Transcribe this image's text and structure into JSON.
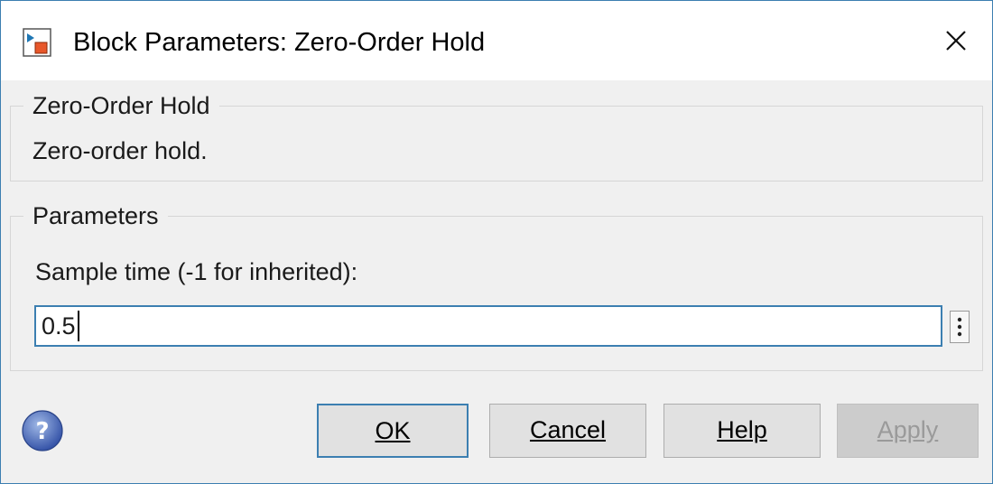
{
  "window": {
    "title": "Block Parameters: Zero-Order Hold",
    "icon": "simulink-block-icon",
    "close_icon": "close-icon"
  },
  "description": {
    "heading": "Zero-Order Hold",
    "text": "Zero-order hold."
  },
  "parameters": {
    "heading": "Parameters",
    "sample_time": {
      "label": "Sample time (-1 for inherited):",
      "value": "0.5"
    },
    "more_options_icon": "vertical-ellipsis-icon"
  },
  "footer": {
    "help_icon": "question-circle-icon",
    "ok_label": "OK",
    "cancel_label": "Cancel",
    "help_label": "Help",
    "apply_label": "Apply",
    "apply_enabled": false
  },
  "colors": {
    "accent": "#3c7fb1",
    "dialog_bg": "#f0f0f0",
    "button_bg": "#e1e1e1",
    "disabled_text": "#9a9a9a"
  }
}
